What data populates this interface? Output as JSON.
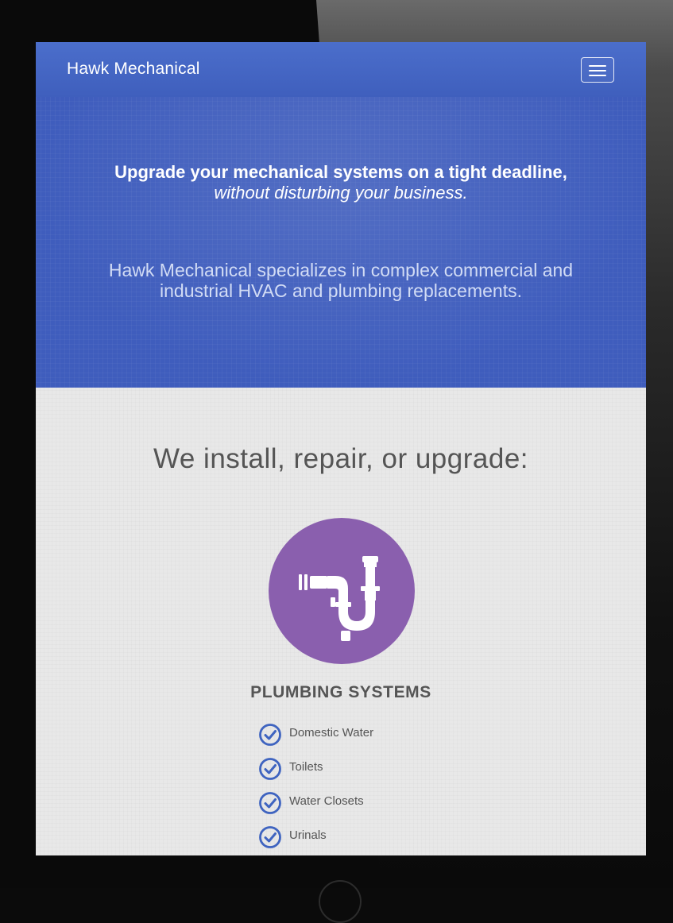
{
  "navbar": {
    "brand": "Hawk Mechanical",
    "menu_icon": "hamburger-menu-icon"
  },
  "hero": {
    "headline": "Upgrade your mechanical systems on a tight deadline,",
    "subline": "without disturbing your business.",
    "description": "Hawk Mechanical specializes in complex commercial and industrial HVAC and plumbing replacements."
  },
  "services": {
    "heading": "We install, repair, or upgrade:",
    "items": [
      {
        "icon": "pipe-trap-icon",
        "title": "PLUMBING SYSTEMS",
        "features": [
          {
            "label": "Domestic Water",
            "icon": "check-circle-icon"
          },
          {
            "label": "Toilets",
            "icon": "check-circle-icon"
          },
          {
            "label": "Water Closets",
            "icon": "check-circle-icon"
          },
          {
            "label": "Urinals",
            "icon": "check-circle-icon"
          }
        ]
      }
    ]
  },
  "colors": {
    "primary_blue": "#3f5dbd",
    "accent_purple": "#8a5fae",
    "check_blue": "#3f64c0",
    "text_gray": "#555555",
    "section_bg": "#e8e8e8"
  }
}
